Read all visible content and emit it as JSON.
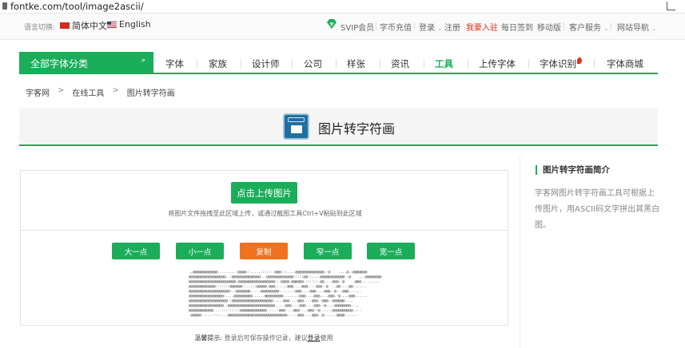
{
  "browser": {
    "url": "fontke.com/tool/image2ascii/"
  },
  "topbar": {
    "lang_label": "语言切换:",
    "lang_cn": "简体中文",
    "lang_en": "English",
    "svip": "SVIP会员",
    "coin": "字币充值",
    "login": "登录",
    "register": "注册",
    "join": "我要入驻",
    "signin": "每日签到",
    "mobile": "移动版",
    "service": "客户服务",
    "sitenav": "网站导航",
    "colors": {
      "accent": "#1aad5a",
      "red": "#e0301e"
    }
  },
  "nav": {
    "all": "全部字体分类",
    "items": [
      "字体",
      "家族",
      "设计师",
      "公司",
      "样张",
      "资讯",
      "工具",
      "上传字体",
      "字体识别",
      "字体商城"
    ],
    "active": "工具"
  },
  "breadcrumb": [
    "字客网",
    "在线工具",
    "图片转字符画"
  ],
  "page": {
    "title": "图片转字符画"
  },
  "tool": {
    "upload": "点击上传图片",
    "hint": "将图片文件拖拽至此区域上传，或通过截图工具Ctrl+V粘贴到此区域",
    "buttons": [
      "大一点",
      "小一点",
      "复制",
      "窄一点",
      "宽一点"
    ],
    "ascii": ".,@@@@@@@@@@@@.........:@@@@::....,:::::::@@@:::....@@@@@@@@@@@@@@.-@    ....@.:@@@@@@@\n@@@@@@@@@@@@@@@@@@..:@@@@@@@@@@@@@@...@@@@@@@@@@@@@:::::@@::....@@@@@@@@@@@@.-@    ...@@@@@@@@\n@@@@@@@@@@@@@@@@@@@@@@@.@@@@@@@@@@@@@@@@@@:.:@@@@.@@@@@@.::::::.@@....@@@.-@    .@@@.........\n@@@@@@@@@@@@@:::::::@@@@@@:...:::@@@@@.@@@:.....@@@....@@@....@@@.-@  ..@@....@@.......\n@@@@@@@@@@@@@@@@@@@@:.:@@@@@@@.....@@@@@@@@@.......:@@@....@@@....@@@.-@...@@@......\n@@@@@@@@@@@@@@@@@:....@@@@@@@@@......@@@@@@@@@.......:@@@....@@@....@@@.-@....@@@......\n@@@@@@@@@@@@@@@@@@@.:@@@@@@@@@@@@@@@@@@@@.....@@@....@@@....@@@.-@@@.-@@@@@@....\n@@@@@@@@@@@@@@@@@.:@@@@@@@@@@@@@@@@@@@@@@@.....@@@....@@@....@@@.-@....@@@@@@@@....\n@@@@@@@@@@@@....:::::::::@@@@@@@@@@@@@......@@@....@@@....@@@.-@......@@@@@@@@@@....\n.@@@@@......:::....@@@@@@@@@@@@@@@@@@@@@@@@@@@@@:....@@@....@@@.-@......@@@@......"
  },
  "tip": {
    "label": "温馨提示:",
    "text": "登录后可保存操作记录，建议",
    "link": "登录",
    "tail": "使用"
  },
  "sidebar": {
    "title": "图片转字符画简介",
    "text": "字客网图片转字符画工具可根据上传图片，用ASCII码文字拼出其黑白图。"
  }
}
